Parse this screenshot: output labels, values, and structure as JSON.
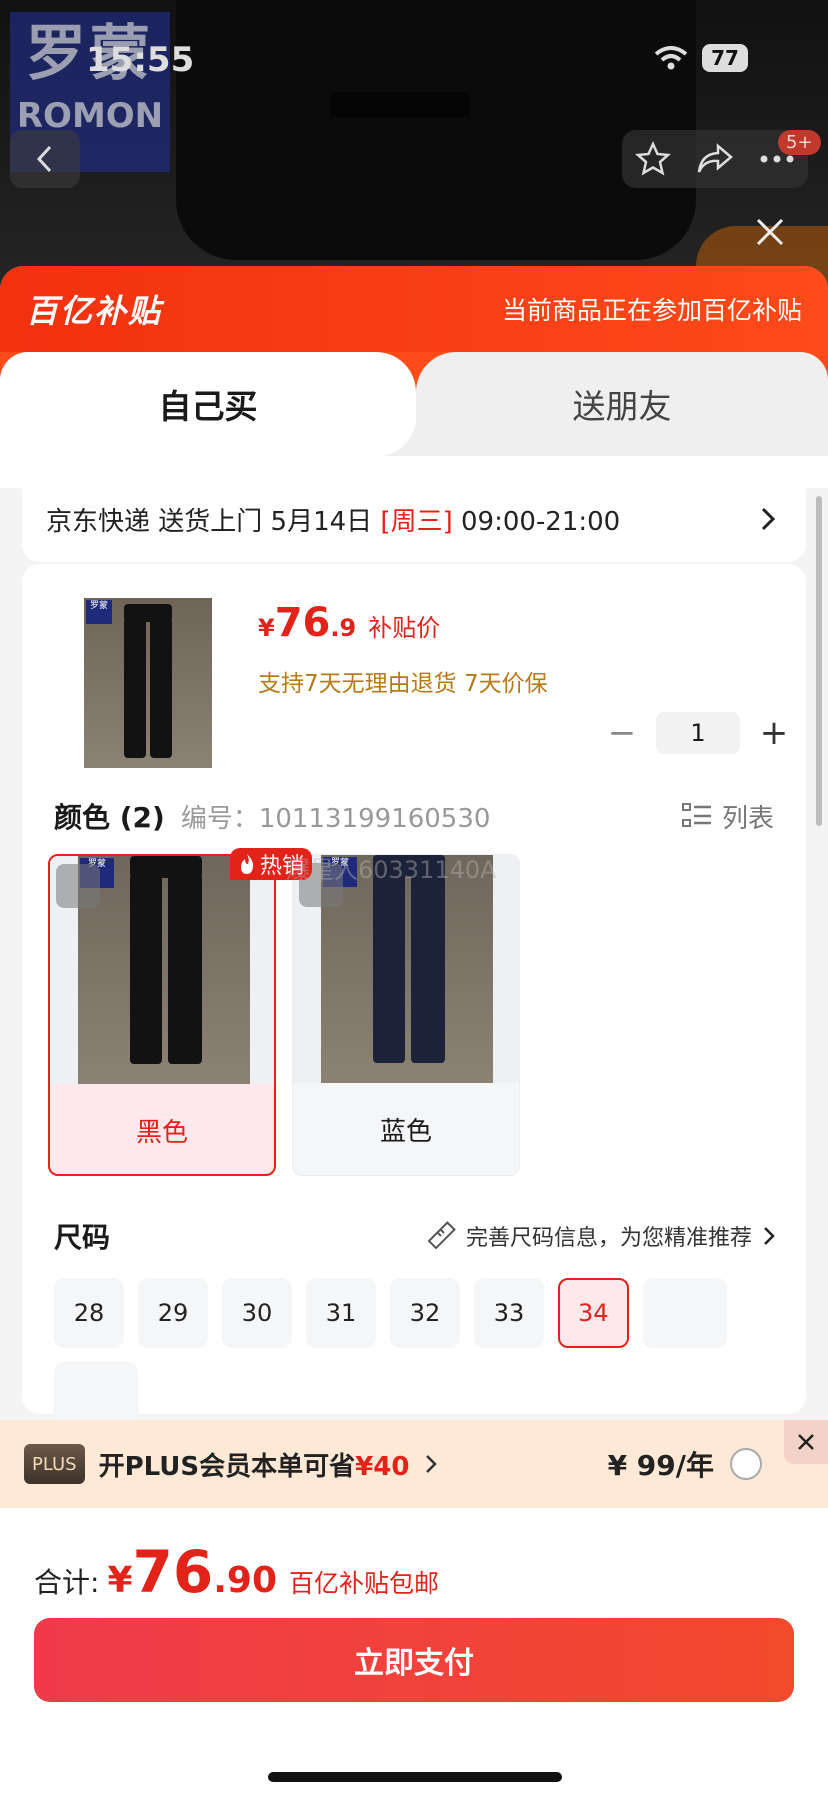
{
  "status_bar": {
    "time": "15:55",
    "battery": "77"
  },
  "background": {
    "brand_logo_cn": "罗蒙",
    "brand_logo_en": "ROMON",
    "cart_badge": "5+"
  },
  "sheet": {
    "brand": "百亿补贴",
    "header_note": "当前商品正在参加百亿补贴",
    "tabs": [
      "自己买",
      "送朋友"
    ]
  },
  "delivery": {
    "prefix": "京东快递 送货上门 5月14日",
    "day": "[周三]",
    "window": "09:00-21:00"
  },
  "product": {
    "thumb_logo": "罗蒙",
    "currency": "¥",
    "price_int": "76",
    "price_dec": ".9",
    "price_tag": "补贴价",
    "guarantee": "支持7天无理由退货   7天价保",
    "quantity": "1",
    "minus": "−",
    "plus": "+"
  },
  "color_section": {
    "title": "颜色 (2)",
    "sku": "编号：10113199160530",
    "list_label": "列表",
    "hot_badge": "热销",
    "watermark": "爆星人60331140A",
    "swatch_logo": "罗蒙",
    "options": [
      {
        "label": "黑色",
        "selected": true
      },
      {
        "label": "蓝色",
        "selected": false
      }
    ]
  },
  "size_section": {
    "title": "尺码",
    "hint": "完善尺码信息，为您精准推荐",
    "sizes": [
      "28",
      "29",
      "30",
      "31",
      "32",
      "33",
      "34"
    ],
    "selected": "34"
  },
  "plus_bar": {
    "chip": "PLUS",
    "text_pre": "开PLUS会员本单可省",
    "save": "¥40",
    "price": "¥ 99/年"
  },
  "footer": {
    "total_label": "合计:",
    "currency": "¥",
    "total_int": "76",
    "total_dec": ".90",
    "shipping": "百亿补贴包邮",
    "pay_button": "立即支付"
  },
  "colors": {
    "accent": "#e2231a",
    "header": "#f2310f",
    "plus_bg": "#fde9d6"
  }
}
